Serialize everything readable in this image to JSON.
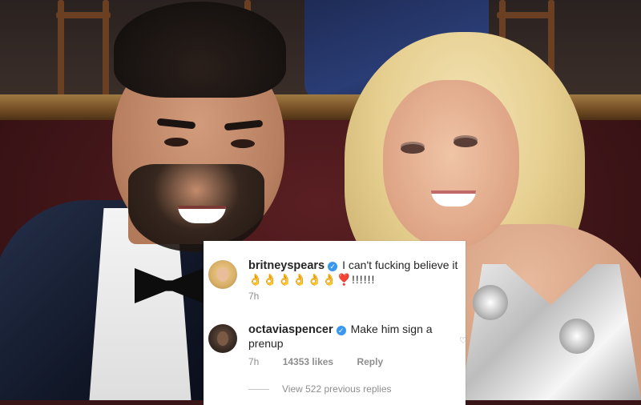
{
  "comments": [
    {
      "username": "britneyspears",
      "verified": true,
      "text_line1": "I can't fucking believe it",
      "text_line2": "👌👌👌👌👌👌❣️!!!!!!",
      "time": "7h"
    },
    {
      "username": "octaviaspencer",
      "verified": true,
      "text": "Make him sign a prenup",
      "time": "7h",
      "likes": "14353 likes",
      "reply_label": "Reply"
    }
  ],
  "view_replies_label": "View 522 previous replies",
  "icons": {
    "verified": "verified-badge-icon",
    "like": "heart-icon"
  },
  "colors": {
    "verified_blue": "#3897f0",
    "meta_gray": "#8e8e8e",
    "text_dark": "#262626"
  }
}
